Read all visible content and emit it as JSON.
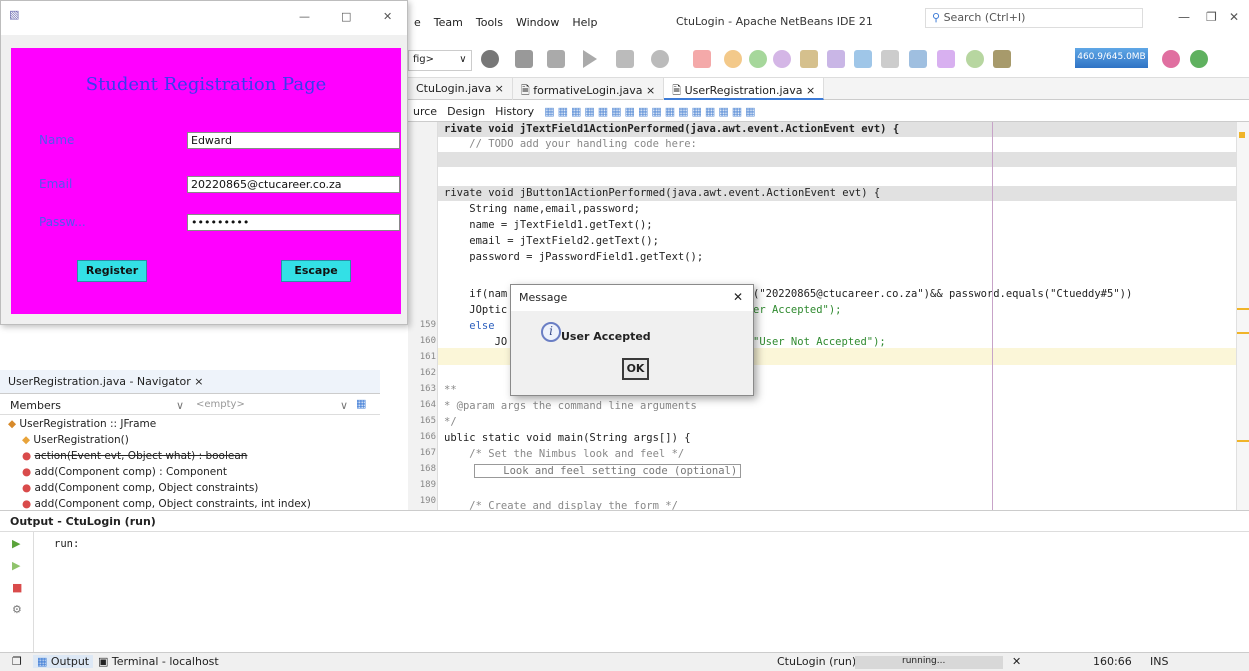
{
  "ide": {
    "menu": [
      "e",
      "Team",
      "Tools",
      "Window",
      "Help"
    ],
    "title": "CtuLogin - Apache NetBeans IDE 21",
    "search_placeholder": "Search (Ctrl+I)",
    "config": "fig>",
    "memory": "460.9/645.0MB",
    "tabs": [
      "CtuLogin.java ×",
      "formativeLogin.java ×",
      "UserRegistration.java ×"
    ],
    "editor_toolbar": [
      "urce",
      "Design",
      "History"
    ]
  },
  "code": {
    "line_numbers": [
      "159",
      "160",
      "161",
      "162",
      "163",
      "164",
      "165",
      "166",
      "167",
      "168",
      "189",
      "190"
    ],
    "lines": [
      "rivate void jTextField1ActionPerformed(java.awt.event.ActionEvent evt) {",
      "    // TODO add your handling code here:",
      "rivate void jButton1ActionPerformed(java.awt.event.ActionEvent evt) {",
      "    String name,email,password;",
      "    name = jTextField1.getText();",
      "    email = jTextField2.getText();",
      "    password = jPasswordField1.getText();",
      "    if(nam",
      "(\"20220865@ctucareer.co.za\")&& password.equals(\"Ctueddy#5\"))",
      "    JOptic",
      "er Accepted\");",
      "    else",
      "        JO",
      "\"User Not Accepted\");",
      "**",
      "* @param args the command line arguments",
      "*/",
      "ublic static void main(String args[]) {",
      "    /* Set the Nimbus look and feel */",
      "    Look and feel setting code (optional)",
      "    /* Create and display the form */"
    ]
  },
  "form": {
    "title": "Student Registration Page",
    "name_label": "Name",
    "name_value": "Edward",
    "email_label": "Email",
    "email_value": "20220865@ctucareer.co.za",
    "password_label": "Passw...",
    "password_value": "•••••••••",
    "register_label": "Register",
    "escape_label": "Escape"
  },
  "dialog": {
    "title": "Message",
    "message": "User Accepted",
    "ok_label": "OK"
  },
  "navigator": {
    "title": "UserRegistration.java - Navigator ×",
    "members_label": "Members",
    "filter": "<empty>",
    "class_node": "UserRegistration :: JFrame",
    "items": [
      "UserRegistration()",
      "action(Event evt, Object what) : boolean",
      "add(Component comp) : Component",
      "add(Component comp, Object constraints)",
      "add(Component comp, Object constraints, int index)"
    ]
  },
  "output": {
    "title": "Output - CtuLogin (run)",
    "text": "run:"
  },
  "status": {
    "output_tab": "Output",
    "terminal_tab": "Terminal - localhost",
    "run_label": "CtuLogin (run)",
    "running": "running...",
    "position": "160:66",
    "mode": "INS"
  }
}
